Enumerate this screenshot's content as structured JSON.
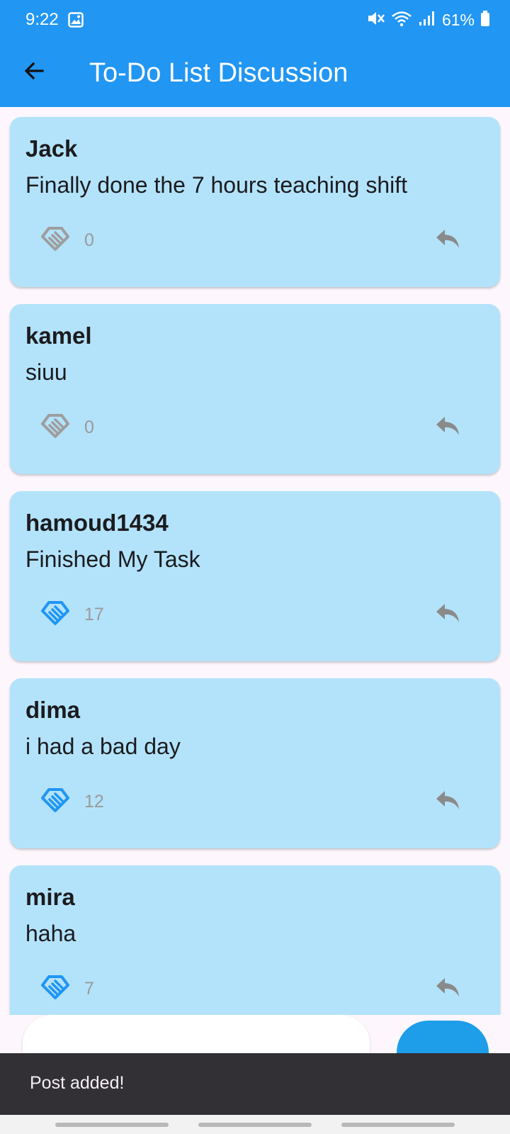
{
  "status_bar": {
    "time": "9:22",
    "battery": "61%",
    "icons": [
      "image-icon",
      "mute-icon",
      "wifi-icon",
      "signal-icon",
      "battery-icon"
    ]
  },
  "app_bar": {
    "title": "To-Do List Discussion",
    "back_icon": "arrow-back-icon",
    "color": "#2196f3"
  },
  "posts": [
    {
      "author": "Jack",
      "text": "Finally done the 7 hours teaching shift",
      "likes": "0",
      "liked": false
    },
    {
      "author": "kamel",
      "text": "siuu",
      "likes": "0",
      "liked": false
    },
    {
      "author": "hamoud1434",
      "text": "Finished My Task",
      "likes": "17",
      "liked": true
    },
    {
      "author": "dima",
      "text": "i had a bad day",
      "likes": "12",
      "liked": true
    },
    {
      "author": "mira",
      "text": "haha",
      "likes": "7",
      "liked": true
    }
  ],
  "colors": {
    "card": "#b3e3fa",
    "like_active": "#2196f3",
    "like_inactive": "#9e9e9e",
    "reply": "#8a8a8a",
    "snackbar": "#322f35"
  },
  "snackbar": {
    "message": "Post added!"
  }
}
